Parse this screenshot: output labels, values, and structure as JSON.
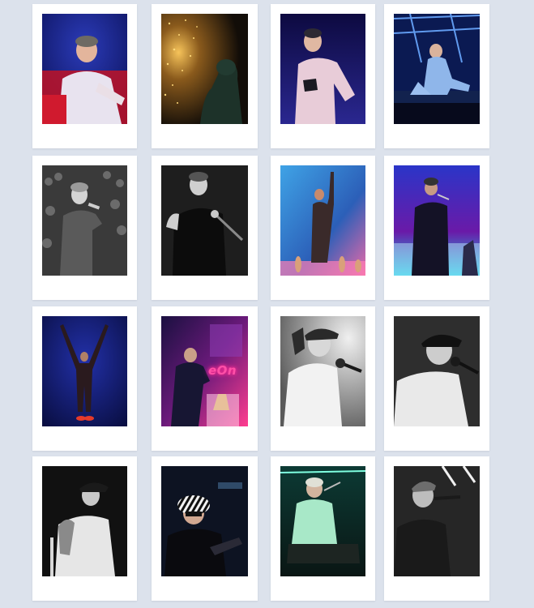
{
  "gallery": {
    "columns": 4,
    "rows": 4,
    "colors": {
      "page_background": "#dce2ec",
      "card_background": "#ffffff"
    },
    "photos": [
      {
        "subject": "performer-red-blue-stage"
      },
      {
        "subject": "performer-silhouette-sparks"
      },
      {
        "subject": "performer-white-hoodie-blue"
      },
      {
        "subject": "performer-seated-blue-stage"
      },
      {
        "subject": "performer-bw-crowd"
      },
      {
        "subject": "performer-bw-mic"
      },
      {
        "subject": "performer-blue-stage-dancers"
      },
      {
        "subject": "performer-purple-mic"
      },
      {
        "subject": "performer-arms-raised-blue"
      },
      {
        "subject": "performer-pink-neon-sign"
      },
      {
        "subject": "performer-bw-cap-mic"
      },
      {
        "subject": "performer-bw-cap-singing"
      },
      {
        "subject": "performer-bw-profile"
      },
      {
        "subject": "performer-zebra-hat"
      },
      {
        "subject": "performer-green-seated"
      },
      {
        "subject": "performer-bw-singing-close"
      }
    ],
    "neon_sign_text": "eOn"
  }
}
